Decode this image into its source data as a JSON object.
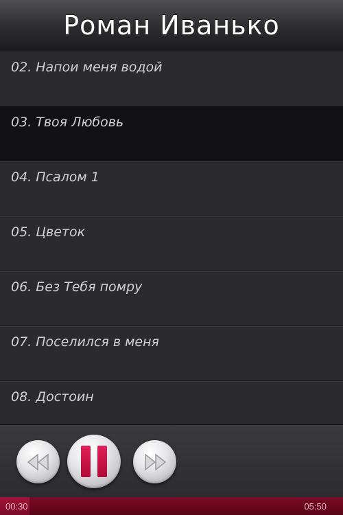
{
  "header": {
    "title": "Роман Иванько"
  },
  "tracks": [
    {
      "label": "02. Напои меня водой",
      "selected": false
    },
    {
      "label": "03. Твоя Любовь",
      "selected": true
    },
    {
      "label": "04. Псалом 1",
      "selected": false
    },
    {
      "label": "05. Цветок",
      "selected": false
    },
    {
      "label": "06. Без Тебя помру",
      "selected": false
    },
    {
      "label": "07. Поселился в меня",
      "selected": false
    },
    {
      "label": "08. Достоин",
      "selected": false
    }
  ],
  "controls": {
    "rewind_icon": "rewind-icon",
    "pause_icon": "pause-icon",
    "forward_icon": "fast-forward-icon",
    "accent": "#c8103f"
  },
  "progress": {
    "elapsed": "00:30",
    "total": "05:50",
    "fraction": 0.086
  }
}
